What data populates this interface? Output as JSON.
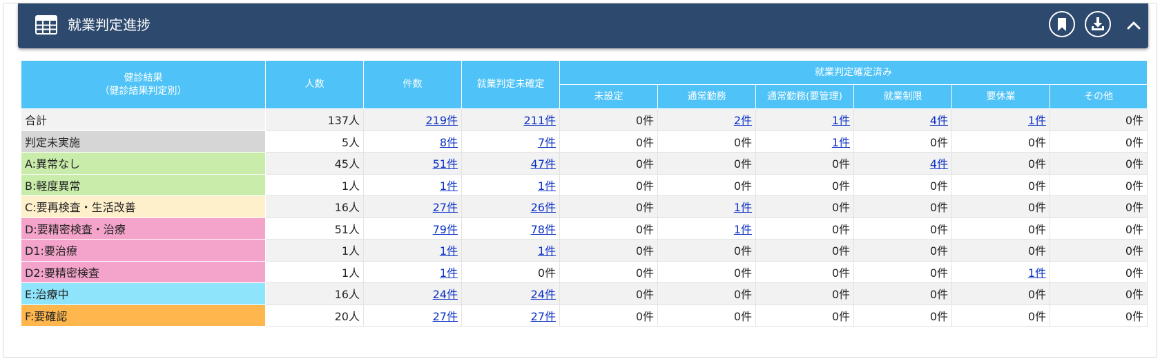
{
  "header": {
    "title": "就業判定進捗"
  },
  "table": {
    "columns": {
      "result": "健診結果",
      "result_sub": "（健診結果判定別）",
      "people": "人数",
      "count": "件数",
      "unconfirmed": "就業判定未確定",
      "confirmed_group": "就業判定確定済み",
      "confirmed": [
        "未設定",
        "通常勤務",
        "通常勤務(要管理)",
        "就業制限",
        "要休業",
        "その他"
      ]
    },
    "rows": [
      {
        "label": "合計",
        "color": "#f2f2f2",
        "cells": [
          "137人",
          "219件",
          "211件",
          "0件",
          "2件",
          "1件",
          "4件",
          "1件",
          "0件"
        ],
        "links": [
          false,
          true,
          true,
          false,
          true,
          true,
          true,
          true,
          false
        ]
      },
      {
        "label": "判定未実施",
        "color": "#d6d6d6",
        "cells": [
          "5人",
          "8件",
          "7件",
          "0件",
          "0件",
          "1件",
          "0件",
          "0件",
          "0件"
        ],
        "links": [
          false,
          true,
          true,
          false,
          false,
          true,
          false,
          false,
          false
        ]
      },
      {
        "label": "A:異常なし",
        "color": "#c9ecaa",
        "cells": [
          "45人",
          "51件",
          "47件",
          "0件",
          "0件",
          "0件",
          "4件",
          "0件",
          "0件"
        ],
        "links": [
          false,
          true,
          true,
          false,
          false,
          false,
          true,
          false,
          false
        ]
      },
      {
        "label": "B:軽度異常",
        "color": "#c9ecaa",
        "cells": [
          "1人",
          "1件",
          "1件",
          "0件",
          "0件",
          "0件",
          "0件",
          "0件",
          "0件"
        ],
        "links": [
          false,
          true,
          true,
          false,
          false,
          false,
          false,
          false,
          false
        ]
      },
      {
        "label": "C:要再検査・生活改善",
        "color": "#fff0cc",
        "cells": [
          "16人",
          "27件",
          "26件",
          "0件",
          "1件",
          "0件",
          "0件",
          "0件",
          "0件"
        ],
        "links": [
          false,
          true,
          true,
          false,
          true,
          false,
          false,
          false,
          false
        ]
      },
      {
        "label": "D:要精密検査・治療",
        "color": "#f4a3ca",
        "cells": [
          "51人",
          "79件",
          "78件",
          "0件",
          "1件",
          "0件",
          "0件",
          "0件",
          "0件"
        ],
        "links": [
          false,
          true,
          true,
          false,
          true,
          false,
          false,
          false,
          false
        ]
      },
      {
        "label": "D1:要治療",
        "color": "#f4a3ca",
        "cells": [
          "1人",
          "1件",
          "1件",
          "0件",
          "0件",
          "0件",
          "0件",
          "0件",
          "0件"
        ],
        "links": [
          false,
          true,
          true,
          false,
          false,
          false,
          false,
          false,
          false
        ]
      },
      {
        "label": "D2:要精密検査",
        "color": "#f4a3ca",
        "cells": [
          "1人",
          "1件",
          "0件",
          "0件",
          "0件",
          "0件",
          "0件",
          "1件",
          "0件"
        ],
        "links": [
          false,
          true,
          false,
          false,
          false,
          false,
          false,
          true,
          false
        ]
      },
      {
        "label": "E:治療中",
        "color": "#8ee4fb",
        "cells": [
          "16人",
          "24件",
          "24件",
          "0件",
          "0件",
          "0件",
          "0件",
          "0件",
          "0件"
        ],
        "links": [
          false,
          true,
          true,
          false,
          false,
          false,
          false,
          false,
          false
        ]
      },
      {
        "label": "F:要確認",
        "color": "#ffb74d",
        "cells": [
          "20人",
          "27件",
          "27件",
          "0件",
          "0件",
          "0件",
          "0件",
          "0件",
          "0件"
        ],
        "links": [
          false,
          true,
          true,
          false,
          false,
          false,
          false,
          false,
          false
        ]
      }
    ]
  },
  "colors": {
    "header_bg": "#2d4a6e",
    "table_header_bg": "#4fc3f7",
    "link": "#0a2fc4"
  }
}
